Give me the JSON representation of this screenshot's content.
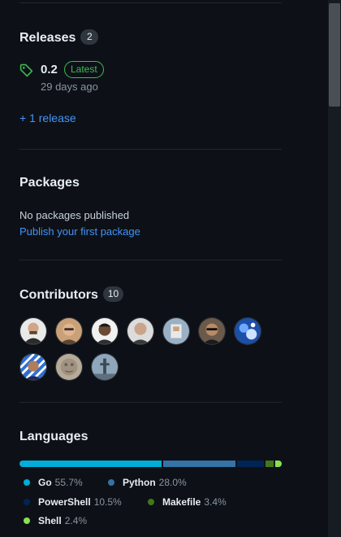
{
  "releases": {
    "title": "Releases",
    "count": "2",
    "latest_version": "0.2",
    "latest_badge": "Latest",
    "latest_time": "29 days ago",
    "more_link": "+ 1 release"
  },
  "packages": {
    "title": "Packages",
    "empty_text": "No packages published",
    "publish_link": "Publish your first package"
  },
  "contributors": {
    "title": "Contributors",
    "count": "10"
  },
  "languages": {
    "title": "Languages",
    "items": [
      {
        "name": "Go",
        "percent": "55.7%",
        "value": 55.7,
        "color": "#00add8"
      },
      {
        "name": "Python",
        "percent": "28.0%",
        "value": 28.0,
        "color": "#3572a5"
      },
      {
        "name": "PowerShell",
        "percent": "10.5%",
        "value": 10.5,
        "color": "#012456"
      },
      {
        "name": "Makefile",
        "percent": "3.4%",
        "value": 3.4,
        "color": "#427819"
      },
      {
        "name": "Shell",
        "percent": "2.4%",
        "value": 2.4,
        "color": "#89e051"
      }
    ]
  },
  "colors": {
    "background": "#0d1117",
    "link": "#4493f8",
    "latest_badge": "#3fb950",
    "muted_text": "#8b949e"
  }
}
